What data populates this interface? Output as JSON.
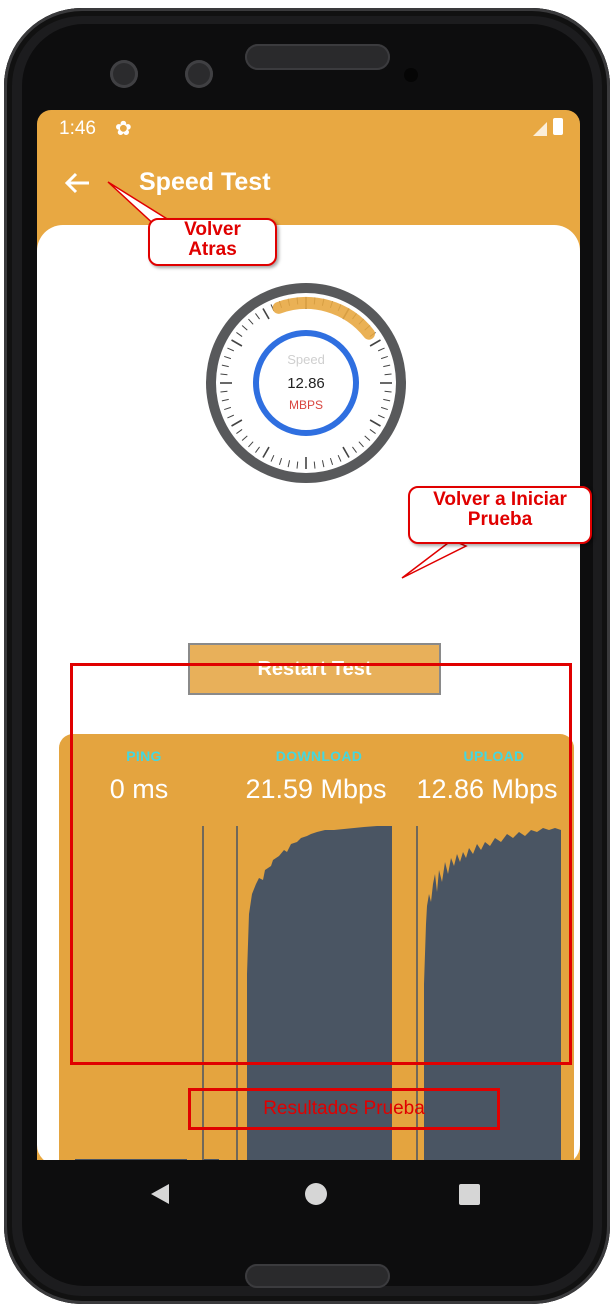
{
  "status_bar": {
    "time": "1:46",
    "settings_icon": "gear-icon",
    "signal_icon": "signal-icon",
    "battery_icon": "battery-icon"
  },
  "app_bar": {
    "title": "Speed Test",
    "back_icon": "arrow-left-icon"
  },
  "gauge": {
    "label": "Speed",
    "value": "12.86",
    "unit": "MBPS",
    "progress_fraction": 0.2
  },
  "restart_button": {
    "label": "Restart Test"
  },
  "results": {
    "columns": [
      {
        "label": "PING",
        "value": "0 ms"
      },
      {
        "label": "DOWNLOAD",
        "value": "21.59 Mbps"
      },
      {
        "label": "UPLOAD",
        "value": "12.86 Mbps"
      }
    ]
  },
  "annotations": {
    "back": "Volver Atras",
    "back_line1": "Volver",
    "back_line2": "Atras",
    "restart_line1": "Volver a Iniciar",
    "restart_line2": "Prueba",
    "results": "Resultados Prueba"
  },
  "nav_bar": {
    "back_icon": "triangle-back-icon",
    "home_icon": "circle-home-icon",
    "recents_icon": "square-recents-icon"
  },
  "colors": {
    "accent": "#e8a842",
    "gauge_ring": "#2f6fe0",
    "unit_text": "#d9453f",
    "graph_fill": "#4a5563",
    "annotation": "#e00000"
  }
}
